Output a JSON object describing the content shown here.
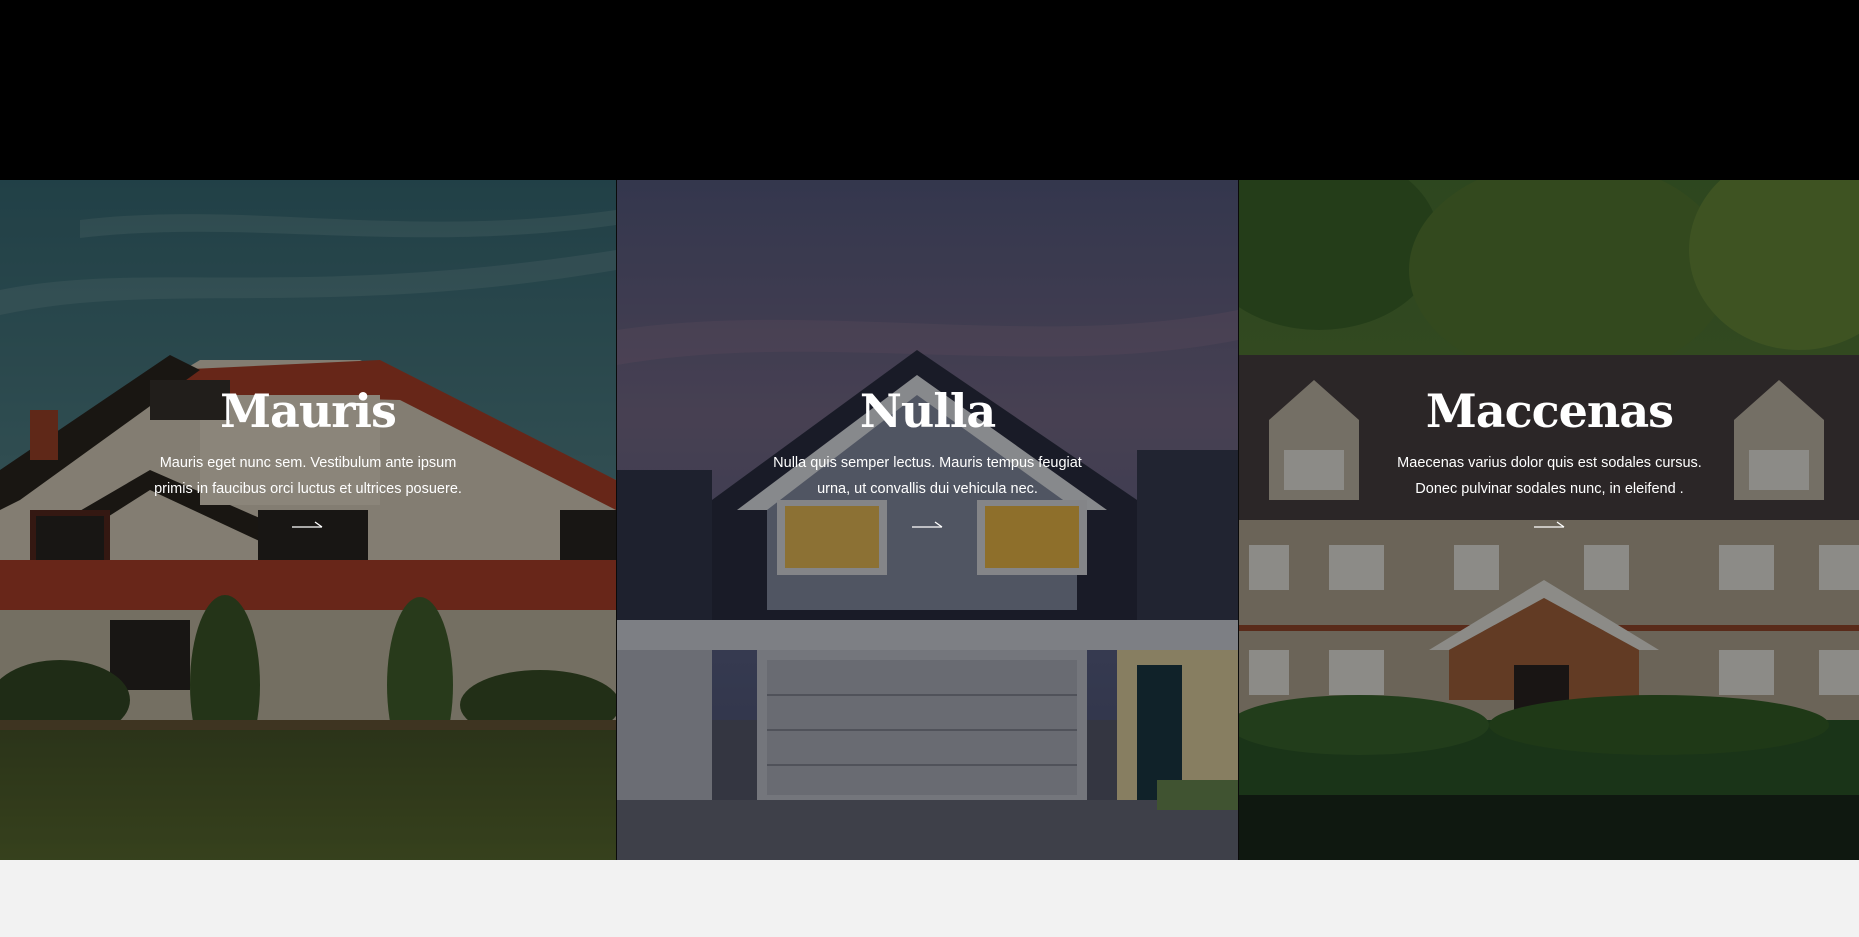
{
  "panels": [
    {
      "title": "Mauris",
      "description": "Mauris eget nunc sem. Vestibulum ante ipsum primis in faucibus orci luctus et ultrices posuere.",
      "arrow_icon": "arrow-right-icon"
    },
    {
      "title": "Nulla",
      "description": "Nulla quis semper lectus. Mauris tempus feugiat urna, ut convallis dui vehicula nec.",
      "arrow_icon": "arrow-right-icon"
    },
    {
      "title": "Maccenas",
      "description": "Maecenas varius dolor quis est sodales cursus. Donec pulvinar sodales nunc, in eleifend .",
      "arrow_icon": "arrow-right-icon"
    }
  ],
  "colors": {
    "top_bar": "#000000",
    "page_background": "#f2f2f2",
    "text": "#ffffff"
  }
}
